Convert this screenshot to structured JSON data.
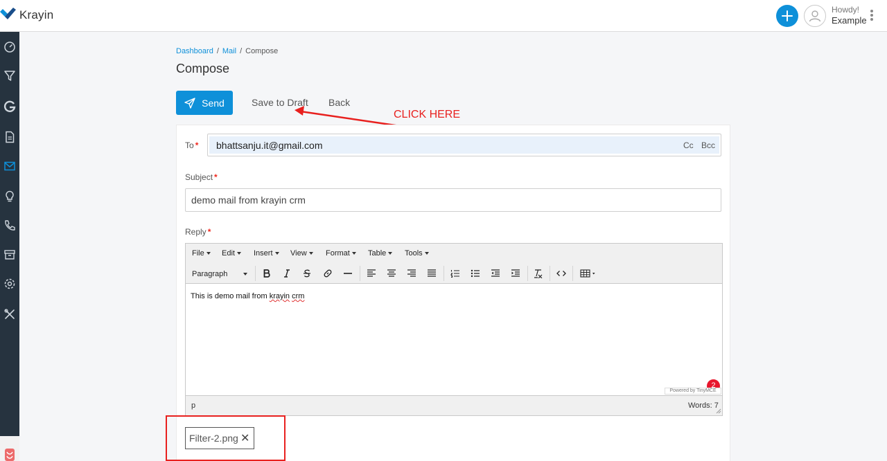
{
  "app": {
    "name": "Krayin"
  },
  "header": {
    "greeting": "Howdy!",
    "user_name": "Example"
  },
  "sidebar": {
    "items": [
      {
        "icon": "dashboard-icon"
      },
      {
        "icon": "filter-icon"
      },
      {
        "icon": "leads-g-icon"
      },
      {
        "icon": "quotes-icon"
      },
      {
        "icon": "mail-icon",
        "active": true
      },
      {
        "icon": "activities-icon"
      },
      {
        "icon": "phone-icon"
      },
      {
        "icon": "products-icon"
      },
      {
        "icon": "settings-icon"
      },
      {
        "icon": "tools-icon"
      }
    ]
  },
  "breadcrumb": {
    "items": [
      "Dashboard",
      "Mail",
      "Compose"
    ],
    "separator": "/"
  },
  "page": {
    "title": "Compose"
  },
  "actions": {
    "send": "Send",
    "save_draft": "Save to Draft",
    "back": "Back"
  },
  "annotation": {
    "text": "CLICK HERE",
    "color": "#e8201e"
  },
  "form": {
    "to_label": "To",
    "to_value": "bhattsanju.it@gmail.com",
    "cc": "Cc",
    "bcc": "Bcc",
    "subject_label": "Subject",
    "subject_value": "demo mail from krayin crm",
    "reply_label": "Reply",
    "required_mark": "*"
  },
  "editor": {
    "menu": [
      "File",
      "Edit",
      "Insert",
      "View",
      "Format",
      "Table",
      "Tools"
    ],
    "block_format": "Paragraph",
    "body_parts": [
      "This is demo mail from ",
      "krayin",
      " ",
      "crm"
    ],
    "powered_by": "Powered by TinyMCE",
    "notification_count": "2",
    "status_path": "p",
    "word_count": "Words: 7"
  },
  "attachment": {
    "file_name": "Filter-2.png"
  },
  "colors": {
    "primary": "#0e90d9",
    "sidebar": "#26333f",
    "required": "#f0281e"
  }
}
